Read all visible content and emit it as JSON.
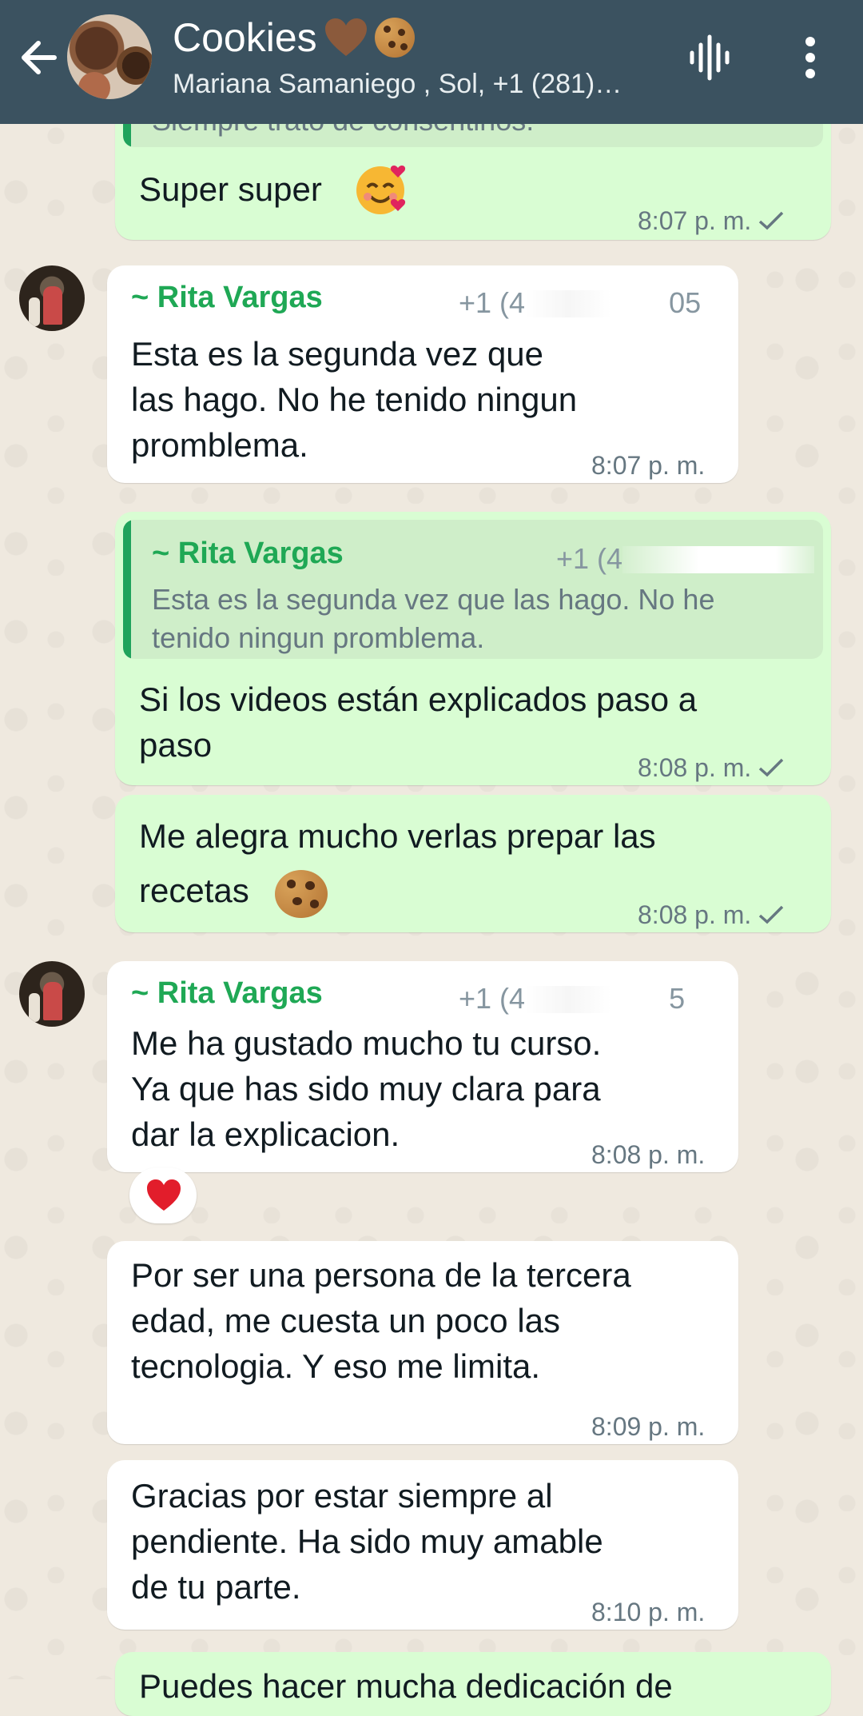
{
  "header": {
    "back_label": "",
    "title": "Cookies",
    "participants": "Mariana Samaniego , Sol, +1 (281)…",
    "icons": [
      "back-arrow-icon",
      "group-avatar",
      "voice-chat-icon",
      "more-options-icon"
    ]
  },
  "messages": [
    {
      "direction": "out",
      "quoted_partial": "Siempre trato de consentirlos.",
      "text": "Super super",
      "emoji": "smiling-face-with-hearts",
      "time": "8:07 p. m.",
      "status": "sent-check"
    },
    {
      "direction": "in",
      "sender": "~ Rita Vargas",
      "phone_visible": "+1 (4",
      "phone_suffix": "05",
      "text": "Esta es la segunda vez que\nlas hago. No he tenido ningun\npromblema.",
      "time": "8:07 p. m."
    },
    {
      "direction": "out",
      "quote": {
        "sender": "~ Rita Vargas",
        "phone_visible": "+1 (4",
        "text": "Esta es la segunda vez que las hago. No he\ntenido ningun promblema."
      },
      "text": "Si los videos están explicados paso a\npaso",
      "time": "8:08 p. m.",
      "status": "sent-check"
    },
    {
      "direction": "out",
      "text": "Me alegra mucho verlas prepar las\nrecetas",
      "emoji": "cookie",
      "time": "8:08 p. m.",
      "status": "sent-check"
    },
    {
      "direction": "in",
      "sender": "~ Rita Vargas",
      "phone_visible": "+1 (4",
      "phone_suffix": "5",
      "text": "Me ha gustado mucho tu curso.\nYa que has sido muy clara para\ndar la explicacion.",
      "time": "8:08 p. m.",
      "reaction": "red-heart"
    },
    {
      "direction": "in",
      "text": "Por ser una persona de la tercera\nedad, me cuesta un poco las\ntecnologia.  Y eso me limita.",
      "time": "8:09 p. m."
    },
    {
      "direction": "in",
      "text": "Gracias por estar siempre al\npendiente.  Ha sido muy amable\nde tu parte.",
      "time": "8:10 p. m."
    },
    {
      "direction": "out",
      "text_partial": "Puedes hacer mucha dedicación de",
      "time": ""
    }
  ],
  "colors": {
    "header_bg": "#3b5260",
    "outgoing_bubble": "#d9fdd3",
    "incoming_bubble": "#ffffff",
    "sender_name": "#1fa855",
    "timestamp": "#667781",
    "wallpaper": "#efe9df"
  }
}
